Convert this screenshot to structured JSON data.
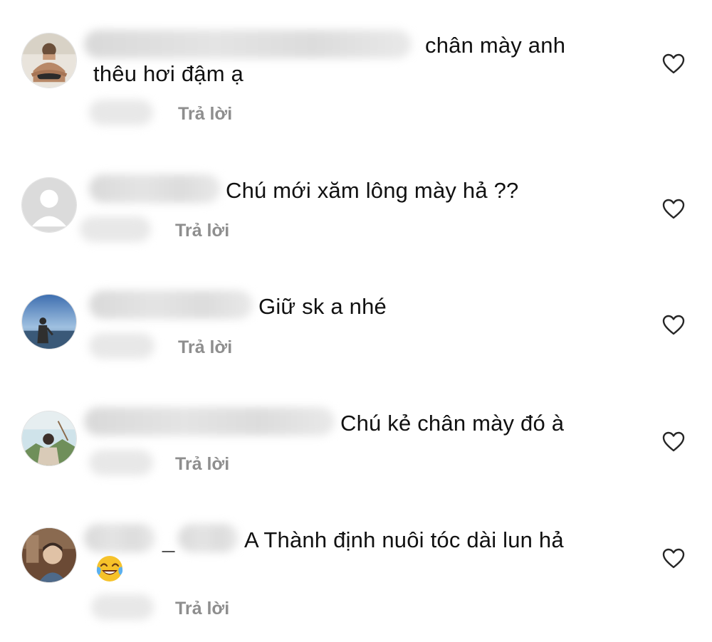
{
  "comments": [
    {
      "text_line1": "chân mày anh",
      "text_line2": "thêu hơi đậm ạ",
      "reply_label": "Trả lời",
      "avatar_icon": "user-photo-avatar",
      "like_icon": "heart-outline-icon"
    },
    {
      "text_line1": "Chú mới xăm lông mày hả ??",
      "reply_label": "Trả lời",
      "avatar_icon": "default-user-avatar",
      "like_icon": "heart-outline-icon"
    },
    {
      "text_line1": "Giữ sk a nhé",
      "reply_label": "Trả lời",
      "avatar_icon": "user-photo-avatar",
      "like_icon": "heart-outline-icon"
    },
    {
      "text_line1": "Chú kẻ chân mày đó à",
      "reply_label": "Trả lời",
      "avatar_icon": "user-photo-avatar",
      "like_icon": "heart-outline-icon"
    },
    {
      "text_line1": "A Thành định nuôi tóc dài lun hả",
      "name_separator": "_",
      "reply_label": "Trả lời",
      "avatar_icon": "user-photo-avatar",
      "like_icon": "heart-outline-icon",
      "emoji": "😂"
    }
  ],
  "colors": {
    "text": "#111111",
    "reply": "#8e8e8e",
    "heart_stroke": "#262626",
    "blur": "#dddddd"
  }
}
